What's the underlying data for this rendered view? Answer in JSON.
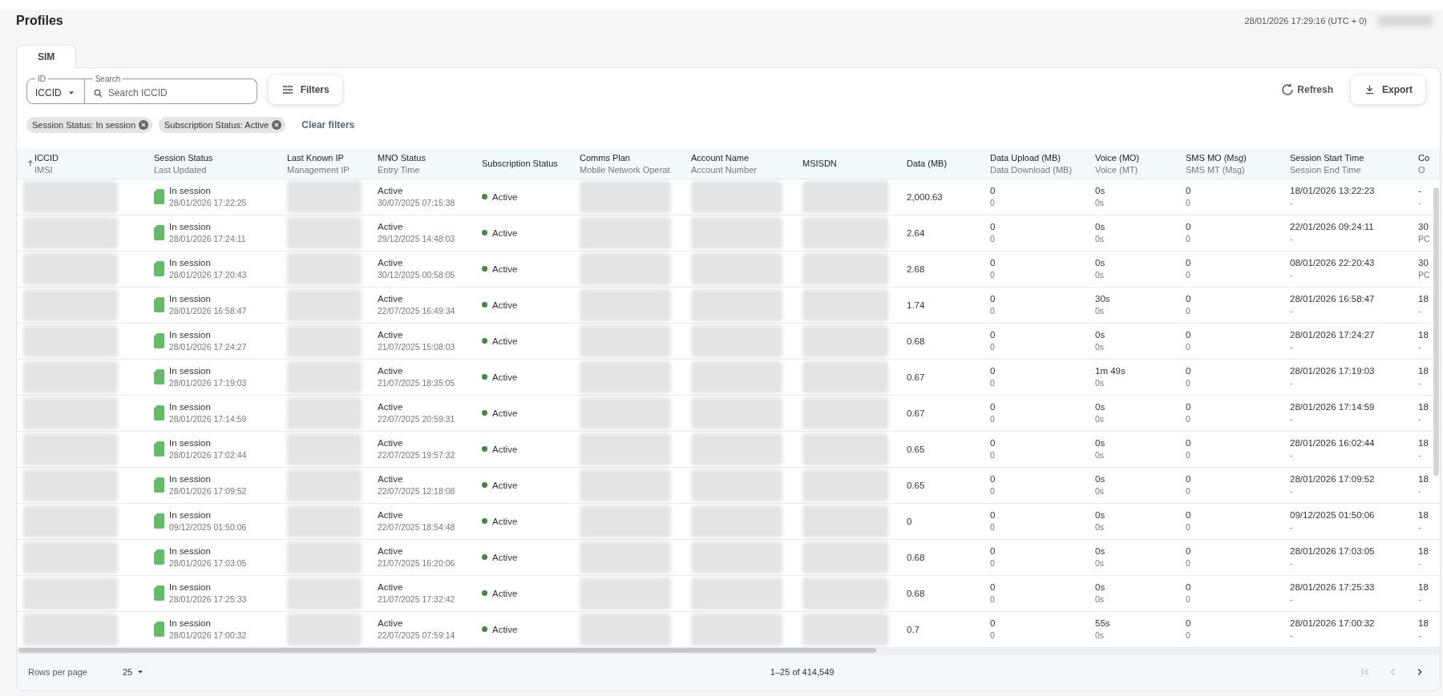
{
  "page": {
    "title": "Profiles",
    "clock": "28/01/2026 17:29:16 (UTC + 0)"
  },
  "tabs": [
    {
      "label": "SIM",
      "selected": true
    }
  ],
  "search": {
    "id_label": "ID",
    "id_value": "ICCID",
    "search_label": "Search",
    "placeholder": "Search ICCID"
  },
  "toolbar": {
    "filters": "Filters",
    "refresh": "Refresh",
    "export": "Export"
  },
  "filter_chips": [
    "Session Status: In session",
    "Subscription Status: Active"
  ],
  "clear_filters": "Clear filters",
  "table": {
    "columns": [
      {
        "title": "ICCID",
        "subtitle": "IMSI",
        "sorted": true
      },
      {
        "title": "Session Status",
        "subtitle": "Last Updated",
        "sorted": false
      },
      {
        "title": "Last Known IP",
        "subtitle": "Management IP",
        "sorted": false
      },
      {
        "title": "MNO Status",
        "subtitle": "Entry Time",
        "sorted": false
      },
      {
        "title": "Subscription Status",
        "sorted": false
      },
      {
        "title": "Comms Plan",
        "subtitle": "Mobile Network Operat",
        "sorted": false
      },
      {
        "title": "Account Name",
        "subtitle": "Account Number",
        "sorted": false
      },
      {
        "title": "MSISDN",
        "sorted": false
      },
      {
        "title": "Data (MB)",
        "sorted": false
      },
      {
        "title": "Data Upload (MB)",
        "subtitle": "Data Download (MB)",
        "sorted": false
      },
      {
        "title": "Voice (MO)",
        "subtitle": "Voice (MT)",
        "sorted": false
      },
      {
        "title": "SMS MO (Msg)",
        "subtitle": "SMS MT (Msg)",
        "sorted": false
      },
      {
        "title": "Session Start Time",
        "subtitle": "Session End Time",
        "sorted": false
      },
      {
        "title": "Co",
        "subtitle": "O",
        "sorted": false
      }
    ],
    "rows": [
      {
        "cells": [
          {
            "kind": "redacted"
          },
          {
            "kind": "session",
            "primary": "In session",
            "secondary": "28/01/2026 17:22:25",
            "color": "#66bb6a"
          },
          {
            "kind": "redacted"
          },
          {
            "kind": "text",
            "primary": "Active",
            "secondary": "30/07/2025 07:15:38"
          },
          {
            "kind": "status",
            "primary": "Active",
            "color": "#3d8b40"
          },
          {
            "kind": "redacted"
          },
          {
            "kind": "redacted"
          },
          {
            "kind": "redacted"
          },
          {
            "kind": "text",
            "primary": "2,000.63"
          },
          {
            "kind": "text",
            "primary": "0",
            "secondary": "0"
          },
          {
            "kind": "text",
            "primary": "0s",
            "secondary": "0s"
          },
          {
            "kind": "text",
            "primary": "0",
            "secondary": "0"
          },
          {
            "kind": "text",
            "primary": "18/01/2026 13:22:23",
            "secondary": "-"
          },
          {
            "kind": "text",
            "primary": "-",
            "secondary": "-"
          }
        ]
      },
      {
        "cells": [
          {
            "kind": "redacted"
          },
          {
            "kind": "session",
            "primary": "In session",
            "secondary": "28/01/2026 17:24:11",
            "color": "#66bb6a"
          },
          {
            "kind": "redacted"
          },
          {
            "kind": "text",
            "primary": "Active",
            "secondary": "29/12/2025 14:48:03"
          },
          {
            "kind": "status",
            "primary": "Active",
            "color": "#3d8b40"
          },
          {
            "kind": "redacted"
          },
          {
            "kind": "redacted"
          },
          {
            "kind": "redacted"
          },
          {
            "kind": "text",
            "primary": "2.64"
          },
          {
            "kind": "text",
            "primary": "0",
            "secondary": "0"
          },
          {
            "kind": "text",
            "primary": "0s",
            "secondary": "0s"
          },
          {
            "kind": "text",
            "primary": "0",
            "secondary": "0"
          },
          {
            "kind": "text",
            "primary": "22/01/2026 09:24:11",
            "secondary": "-"
          },
          {
            "kind": "text",
            "primary": "30",
            "secondary": "PC"
          }
        ]
      },
      {
        "cells": [
          {
            "kind": "redacted"
          },
          {
            "kind": "session",
            "primary": "In session",
            "secondary": "28/01/2026 17:20:43",
            "color": "#66bb6a"
          },
          {
            "kind": "redacted"
          },
          {
            "kind": "text",
            "primary": "Active",
            "secondary": "30/12/2025 00:58:05"
          },
          {
            "kind": "status",
            "primary": "Active",
            "color": "#3d8b40"
          },
          {
            "kind": "redacted"
          },
          {
            "kind": "redacted"
          },
          {
            "kind": "redacted"
          },
          {
            "kind": "text",
            "primary": "2.68"
          },
          {
            "kind": "text",
            "primary": "0",
            "secondary": "0"
          },
          {
            "kind": "text",
            "primary": "0s",
            "secondary": "0s"
          },
          {
            "kind": "text",
            "primary": "0",
            "secondary": "0"
          },
          {
            "kind": "text",
            "primary": "08/01/2026 22:20:43",
            "secondary": "-"
          },
          {
            "kind": "text",
            "primary": "30",
            "secondary": "PC"
          }
        ]
      },
      {
        "cells": [
          {
            "kind": "redacted"
          },
          {
            "kind": "session",
            "primary": "In session",
            "secondary": "28/01/2026 16:58:47",
            "color": "#66bb6a"
          },
          {
            "kind": "redacted"
          },
          {
            "kind": "text",
            "primary": "Active",
            "secondary": "22/07/2025 16:49:34"
          },
          {
            "kind": "status",
            "primary": "Active",
            "color": "#3d8b40"
          },
          {
            "kind": "redacted"
          },
          {
            "kind": "redacted"
          },
          {
            "kind": "redacted"
          },
          {
            "kind": "text",
            "primary": "1.74"
          },
          {
            "kind": "text",
            "primary": "0",
            "secondary": "0"
          },
          {
            "kind": "text",
            "primary": "30s",
            "secondary": "0s"
          },
          {
            "kind": "text",
            "primary": "0",
            "secondary": "0"
          },
          {
            "kind": "text",
            "primary": "28/01/2026 16:58:47",
            "secondary": "-"
          },
          {
            "kind": "text",
            "primary": "18",
            "secondary": "-"
          }
        ]
      },
      {
        "cells": [
          {
            "kind": "redacted"
          },
          {
            "kind": "session",
            "primary": "In session",
            "secondary": "28/01/2026 17:24:27",
            "color": "#66bb6a"
          },
          {
            "kind": "redacted"
          },
          {
            "kind": "text",
            "primary": "Active",
            "secondary": "21/07/2025 15:08:03"
          },
          {
            "kind": "status",
            "primary": "Active",
            "color": "#3d8b40"
          },
          {
            "kind": "redacted"
          },
          {
            "kind": "redacted"
          },
          {
            "kind": "redacted"
          },
          {
            "kind": "text",
            "primary": "0.68"
          },
          {
            "kind": "text",
            "primary": "0",
            "secondary": "0"
          },
          {
            "kind": "text",
            "primary": "0s",
            "secondary": "0s"
          },
          {
            "kind": "text",
            "primary": "0",
            "secondary": "0"
          },
          {
            "kind": "text",
            "primary": "28/01/2026 17:24:27",
            "secondary": "-"
          },
          {
            "kind": "text",
            "primary": "18",
            "secondary": "-"
          }
        ]
      },
      {
        "cells": [
          {
            "kind": "redacted"
          },
          {
            "kind": "session",
            "primary": "In session",
            "secondary": "28/01/2026 17:19:03",
            "color": "#66bb6a"
          },
          {
            "kind": "redacted"
          },
          {
            "kind": "text",
            "primary": "Active",
            "secondary": "21/07/2025 18:35:05"
          },
          {
            "kind": "status",
            "primary": "Active",
            "color": "#3d8b40"
          },
          {
            "kind": "redacted"
          },
          {
            "kind": "redacted"
          },
          {
            "kind": "redacted"
          },
          {
            "kind": "text",
            "primary": "0.67"
          },
          {
            "kind": "text",
            "primary": "0",
            "secondary": "0"
          },
          {
            "kind": "text",
            "primary": "1m 49s",
            "secondary": "0s"
          },
          {
            "kind": "text",
            "primary": "0",
            "secondary": "0"
          },
          {
            "kind": "text",
            "primary": "28/01/2026 17:19:03",
            "secondary": "-"
          },
          {
            "kind": "text",
            "primary": "18",
            "secondary": "-"
          }
        ]
      },
      {
        "cells": [
          {
            "kind": "redacted"
          },
          {
            "kind": "session",
            "primary": "In session",
            "secondary": "28/01/2026 17:14:59",
            "color": "#66bb6a"
          },
          {
            "kind": "redacted"
          },
          {
            "kind": "text",
            "primary": "Active",
            "secondary": "22/07/2025 20:59:31"
          },
          {
            "kind": "status",
            "primary": "Active",
            "color": "#3d8b40"
          },
          {
            "kind": "redacted"
          },
          {
            "kind": "redacted"
          },
          {
            "kind": "redacted"
          },
          {
            "kind": "text",
            "primary": "0.67"
          },
          {
            "kind": "text",
            "primary": "0",
            "secondary": "0"
          },
          {
            "kind": "text",
            "primary": "0s",
            "secondary": "0s"
          },
          {
            "kind": "text",
            "primary": "0",
            "secondary": "0"
          },
          {
            "kind": "text",
            "primary": "28/01/2026 17:14:59",
            "secondary": "-"
          },
          {
            "kind": "text",
            "primary": "18",
            "secondary": "-"
          }
        ]
      },
      {
        "cells": [
          {
            "kind": "redacted"
          },
          {
            "kind": "session",
            "primary": "In session",
            "secondary": "28/01/2026 17:02:44",
            "color": "#66bb6a"
          },
          {
            "kind": "redacted"
          },
          {
            "kind": "text",
            "primary": "Active",
            "secondary": "22/07/2025 19:57:32"
          },
          {
            "kind": "status",
            "primary": "Active",
            "color": "#3d8b40"
          },
          {
            "kind": "redacted"
          },
          {
            "kind": "redacted"
          },
          {
            "kind": "redacted"
          },
          {
            "kind": "text",
            "primary": "0.65"
          },
          {
            "kind": "text",
            "primary": "0",
            "secondary": "0"
          },
          {
            "kind": "text",
            "primary": "0s",
            "secondary": "0s"
          },
          {
            "kind": "text",
            "primary": "0",
            "secondary": "0"
          },
          {
            "kind": "text",
            "primary": "28/01/2026 16:02:44",
            "secondary": "-"
          },
          {
            "kind": "text",
            "primary": "18",
            "secondary": "-"
          }
        ]
      },
      {
        "cells": [
          {
            "kind": "redacted"
          },
          {
            "kind": "session",
            "primary": "In session",
            "secondary": "28/01/2026 17:09:52",
            "color": "#66bb6a"
          },
          {
            "kind": "redacted"
          },
          {
            "kind": "text",
            "primary": "Active",
            "secondary": "22/07/2025 12:18:08"
          },
          {
            "kind": "status",
            "primary": "Active",
            "color": "#3d8b40"
          },
          {
            "kind": "redacted"
          },
          {
            "kind": "redacted"
          },
          {
            "kind": "redacted"
          },
          {
            "kind": "text",
            "primary": "0.65"
          },
          {
            "kind": "text",
            "primary": "0",
            "secondary": "0"
          },
          {
            "kind": "text",
            "primary": "0s",
            "secondary": "0s"
          },
          {
            "kind": "text",
            "primary": "0",
            "secondary": "0"
          },
          {
            "kind": "text",
            "primary": "28/01/2026 17:09:52",
            "secondary": "-"
          },
          {
            "kind": "text",
            "primary": "18",
            "secondary": "-"
          }
        ]
      },
      {
        "cells": [
          {
            "kind": "redacted"
          },
          {
            "kind": "session",
            "primary": "In session",
            "secondary": "09/12/2025 01:50:06",
            "color": "#66bb6a"
          },
          {
            "kind": "redacted"
          },
          {
            "kind": "text",
            "primary": "Active",
            "secondary": "22/07/2025 18:54:48"
          },
          {
            "kind": "status",
            "primary": "Active",
            "color": "#3d8b40"
          },
          {
            "kind": "redacted"
          },
          {
            "kind": "redacted"
          },
          {
            "kind": "redacted"
          },
          {
            "kind": "text",
            "primary": "0"
          },
          {
            "kind": "text",
            "primary": "0",
            "secondary": "0"
          },
          {
            "kind": "text",
            "primary": "0s",
            "secondary": "0s"
          },
          {
            "kind": "text",
            "primary": "0",
            "secondary": "0"
          },
          {
            "kind": "text",
            "primary": "09/12/2025 01:50:06",
            "secondary": "-"
          },
          {
            "kind": "text",
            "primary": "18",
            "secondary": "-"
          }
        ]
      },
      {
        "cells": [
          {
            "kind": "redacted"
          },
          {
            "kind": "session",
            "primary": "In session",
            "secondary": "28/01/2026 17:03:05",
            "color": "#66bb6a"
          },
          {
            "kind": "redacted"
          },
          {
            "kind": "text",
            "primary": "Active",
            "secondary": "21/07/2025 16:20:06"
          },
          {
            "kind": "status",
            "primary": "Active",
            "color": "#3d8b40"
          },
          {
            "kind": "redacted"
          },
          {
            "kind": "redacted"
          },
          {
            "kind": "redacted"
          },
          {
            "kind": "text",
            "primary": "0.68"
          },
          {
            "kind": "text",
            "primary": "0",
            "secondary": "0"
          },
          {
            "kind": "text",
            "primary": "0s",
            "secondary": "0s"
          },
          {
            "kind": "text",
            "primary": "0",
            "secondary": "0"
          },
          {
            "kind": "text",
            "primary": "28/01/2026 17:03:05",
            "secondary": "-"
          },
          {
            "kind": "text",
            "primary": "18",
            "secondary": "-"
          }
        ]
      },
      {
        "cells": [
          {
            "kind": "redacted"
          },
          {
            "kind": "session",
            "primary": "In session",
            "secondary": "28/01/2026 17:25:33",
            "color": "#66bb6a"
          },
          {
            "kind": "redacted"
          },
          {
            "kind": "text",
            "primary": "Active",
            "secondary": "21/07/2025 17:32:42"
          },
          {
            "kind": "status",
            "primary": "Active",
            "color": "#3d8b40"
          },
          {
            "kind": "redacted"
          },
          {
            "kind": "redacted"
          },
          {
            "kind": "redacted"
          },
          {
            "kind": "text",
            "primary": "0.68"
          },
          {
            "kind": "text",
            "primary": "0",
            "secondary": "0"
          },
          {
            "kind": "text",
            "primary": "0s",
            "secondary": "0s"
          },
          {
            "kind": "text",
            "primary": "0",
            "secondary": "0"
          },
          {
            "kind": "text",
            "primary": "28/01/2026 17:25:33",
            "secondary": "-"
          },
          {
            "kind": "text",
            "primary": "18",
            "secondary": "-"
          }
        ]
      },
      {
        "cells": [
          {
            "kind": "redacted"
          },
          {
            "kind": "session",
            "primary": "In session",
            "secondary": "28/01/2026 17:00:32",
            "color": "#66bb6a"
          },
          {
            "kind": "redacted"
          },
          {
            "kind": "text",
            "primary": "Active",
            "secondary": "22/07/2025 07:59:14"
          },
          {
            "kind": "status",
            "primary": "Active",
            "color": "#3d8b40"
          },
          {
            "kind": "redacted"
          },
          {
            "kind": "redacted"
          },
          {
            "kind": "redacted"
          },
          {
            "kind": "text",
            "primary": "0.7"
          },
          {
            "kind": "text",
            "primary": "0",
            "secondary": "0"
          },
          {
            "kind": "text",
            "primary": "55s",
            "secondary": "0s"
          },
          {
            "kind": "text",
            "primary": "0",
            "secondary": "0"
          },
          {
            "kind": "text",
            "primary": "28/01/2026 17:00:32",
            "secondary": "-"
          },
          {
            "kind": "text",
            "primary": "18",
            "secondary": "-"
          }
        ]
      }
    ]
  },
  "pagination": {
    "rows_label": "Rows per page",
    "rows_value": "25",
    "range": "1–25 of 414,549",
    "first_disabled": true,
    "prev_disabled": true,
    "next_disabled": false
  }
}
